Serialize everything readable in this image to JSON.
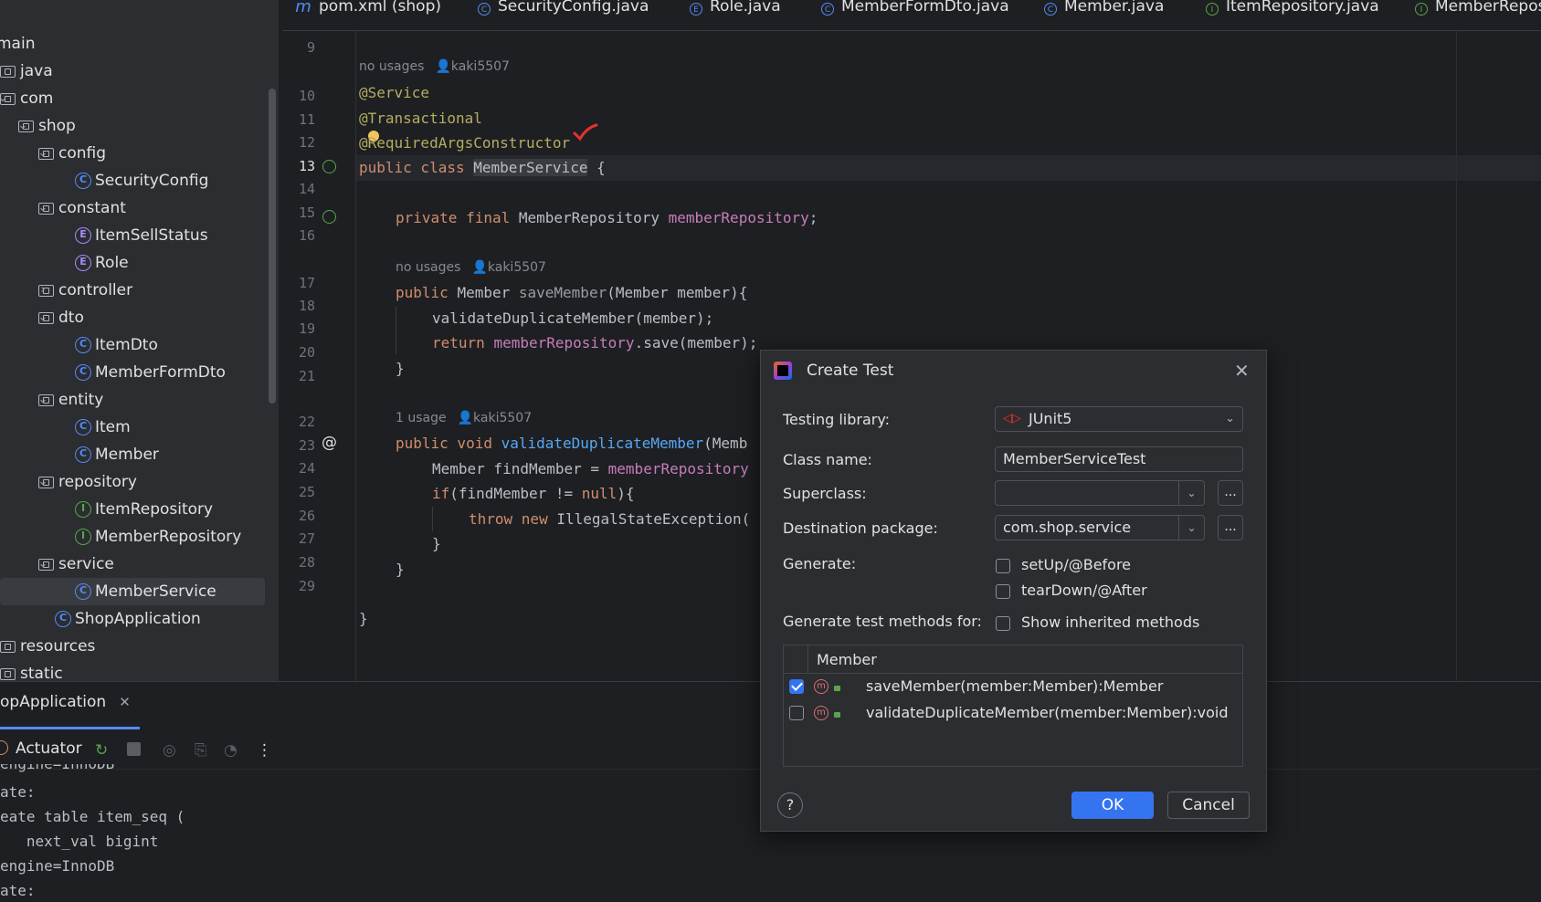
{
  "tabs": [
    {
      "label": "pom.xml (shop)",
      "icon": "maven-icon"
    },
    {
      "label": "SecurityConfig.java",
      "icon": "class-icon"
    },
    {
      "label": "Role.java",
      "icon": "enum-icon"
    },
    {
      "label": "MemberFormDto.java",
      "icon": "class-icon"
    },
    {
      "label": "Member.java",
      "icon": "class-icon"
    },
    {
      "label": "ItemRepository.java",
      "icon": "interface-icon"
    },
    {
      "label": "MemberReposi",
      "icon": "interface-icon"
    }
  ],
  "tree": [
    {
      "label": "main",
      "icon": "none",
      "arrow": ""
    },
    {
      "label": "java",
      "icon": "folder",
      "arrow": ""
    },
    {
      "label": "com",
      "icon": "folder",
      "arrow": "⌄"
    },
    {
      "label": "shop",
      "icon": "folder",
      "arrow": "⌄"
    },
    {
      "label": "config",
      "icon": "folder",
      "arrow": "⌄"
    },
    {
      "label": "SecurityConfig",
      "icon": "class",
      "arrow": ""
    },
    {
      "label": "constant",
      "icon": "folder",
      "arrow": "⌄"
    },
    {
      "label": "ItemSellStatus",
      "icon": "enum",
      "arrow": ""
    },
    {
      "label": "Role",
      "icon": "enum",
      "arrow": ""
    },
    {
      "label": "controller",
      "icon": "folder",
      "arrow": "›"
    },
    {
      "label": "dto",
      "icon": "folder",
      "arrow": "⌄"
    },
    {
      "label": "ItemDto",
      "icon": "class",
      "arrow": ""
    },
    {
      "label": "MemberFormDto",
      "icon": "class",
      "arrow": ""
    },
    {
      "label": "entity",
      "icon": "folder",
      "arrow": "⌄"
    },
    {
      "label": "Item",
      "icon": "class",
      "arrow": ""
    },
    {
      "label": "Member",
      "icon": "class",
      "arrow": ""
    },
    {
      "label": "repository",
      "icon": "folder",
      "arrow": "⌄"
    },
    {
      "label": "ItemRepository",
      "icon": "interface",
      "arrow": ""
    },
    {
      "label": "MemberRepository",
      "icon": "interface",
      "arrow": ""
    },
    {
      "label": "service",
      "icon": "folder",
      "arrow": "⌄"
    },
    {
      "label": "MemberService",
      "icon": "class",
      "arrow": "",
      "selected": true
    },
    {
      "label": "ShopApplication",
      "icon": "class",
      "arrow": ""
    },
    {
      "label": "resources",
      "icon": "folder",
      "arrow": ""
    },
    {
      "label": "static",
      "icon": "folder",
      "arrow": ""
    }
  ],
  "editor": {
    "line_numbers": [
      "9",
      "10",
      "11",
      "12",
      "13",
      "14",
      "15",
      "16",
      "17",
      "18",
      "19",
      "20",
      "21",
      "22",
      "23",
      "24",
      "25",
      "26",
      "27",
      "28",
      "29"
    ],
    "hints": [
      {
        "usages": "no usages",
        "author": "kaki5507"
      },
      {
        "usages": "no usages",
        "author": "kaki5507"
      },
      {
        "usages": "1 usage",
        "author": "kaki5507"
      }
    ],
    "code": {
      "l10": "@Service",
      "l11": "@Transactional",
      "l12": "@RequiredArgsConstructor",
      "l13_kw": "public class ",
      "l13_name": "MemberService",
      "l13_rest": " {",
      "l15_kw": "private final ",
      "l15_type": "MemberRepository ",
      "l15_field": "memberRepository",
      "l15_end": ";",
      "l17_kw": "public ",
      "l17_type": "Member ",
      "l17_fn": "saveMember",
      "l17_rest": "(Member member){",
      "l18": "validateDuplicateMember(member);",
      "l19_kw": "return ",
      "l19_field": "memberRepository",
      "l19_rest": ".save(member);",
      "l20": "}",
      "l22_kw": "public void ",
      "l22_fn": "validateDuplicateMember",
      "l22_rest": "(Memb",
      "l23_type": "Member findMember = ",
      "l23_field": "memberRepository",
      "l24_kw": "if",
      "l24_a": "(findMember != ",
      "l24_null": "null",
      "l24_b": "){",
      "l25_kw": "throw new ",
      "l25_rest": "IllegalStateException(",
      "l26": "}",
      "l27": "}",
      "l29": "}"
    }
  },
  "bottom": {
    "run_tab": "opApplication",
    "actuator": "Actuator",
    "console": [
      "engine=InnoDB",
      "ate:",
      "eate table item_seq (",
      "   next_val bigint",
      "engine=InnoDB",
      "ate:"
    ]
  },
  "dialog": {
    "title": "Create Test",
    "testing_library_label": "Testing library:",
    "testing_library_value": "JUnit5",
    "class_name_label": "Class name:",
    "class_name_value": "MemberServiceTest",
    "superclass_label": "Superclass:",
    "superclass_value": "",
    "dest_package_label": "Destination package:",
    "dest_package_value": "com.shop.service",
    "browse_label": "...",
    "generate_label": "Generate:",
    "setup_label": "setUp/@Before",
    "teardown_label": "tearDown/@After",
    "gen_methods_label": "Generate test methods for:",
    "show_inherited_label": "Show inherited methods",
    "table_header": "Member",
    "methods": [
      {
        "label": "saveMember(member:Member):Member",
        "checked": true
      },
      {
        "label": "validateDuplicateMember(member:Member):void",
        "checked": false
      }
    ],
    "help_label": "?",
    "ok_label": "OK",
    "cancel_label": "Cancel"
  }
}
